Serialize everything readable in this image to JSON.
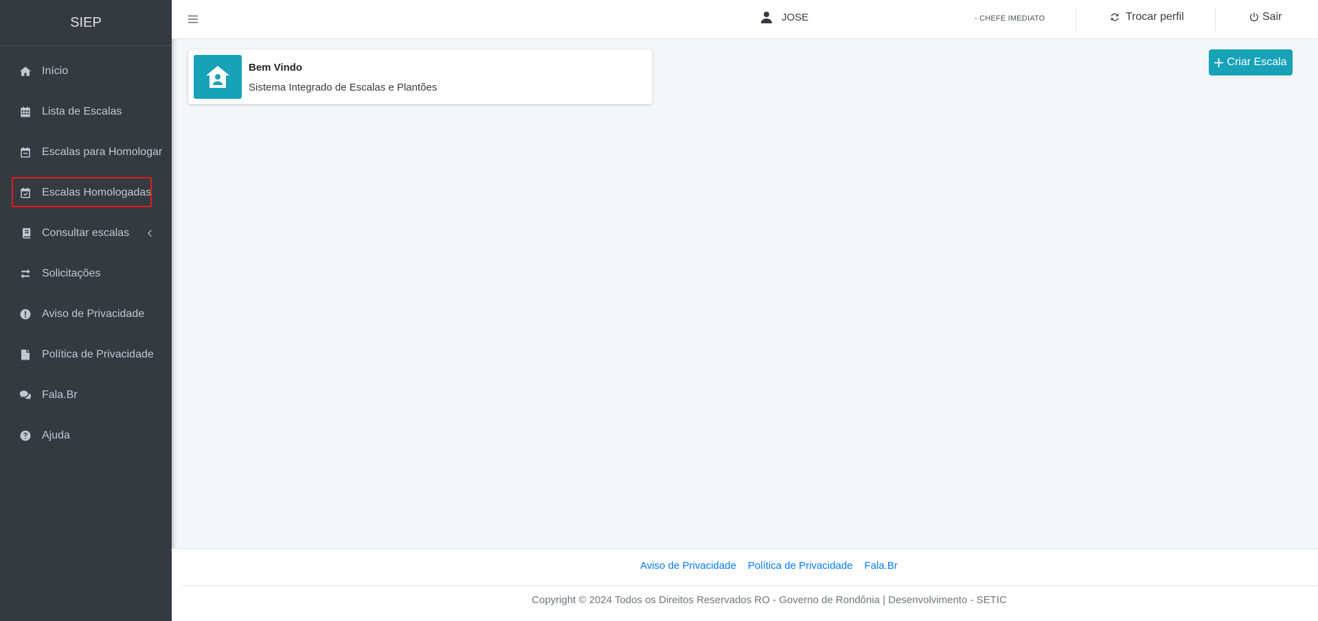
{
  "app": {
    "brand": "SIEP"
  },
  "sidebar": {
    "items": [
      {
        "label": "Início",
        "icon": "home-icon"
      },
      {
        "label": "Lista de Escalas",
        "icon": "calendar-grid-icon"
      },
      {
        "label": "Escalas para Homologar",
        "icon": "calendar-minus-icon"
      },
      {
        "label": "Escalas Homologadas",
        "icon": "calendar-check-icon"
      },
      {
        "label": "Consultar escalas",
        "icon": "book-icon"
      },
      {
        "label": "Solicitações",
        "icon": "exchange-icon"
      },
      {
        "label": "Aviso de Privacidade",
        "icon": "exclamation-circle-icon"
      },
      {
        "label": "Política de Privacidade",
        "icon": "file-icon"
      },
      {
        "label": "Fala.Br",
        "icon": "comments-icon"
      },
      {
        "label": "Ajuda",
        "icon": "question-circle-icon"
      }
    ]
  },
  "header": {
    "user_name": "JOSE",
    "role": "- CHEFE IMEDIATO",
    "switch_profile": "Trocar perfil",
    "logout": "Sair"
  },
  "welcome": {
    "title": "Bem Vindo",
    "subtitle": "Sistema Integrado de Escalas e Plantões"
  },
  "actions": {
    "create_label": "Criar Escala"
  },
  "footer": {
    "links": [
      "Aviso de Privacidade",
      "Política de Privacidade",
      "Fala.Br"
    ],
    "copyright": "Copyright © 2024 Todos os Direitos Reservados RO - Governo de Rondônia | Desenvolvimento - SETIC"
  },
  "colors": {
    "sidebar_bg": "#343a40",
    "accent": "#17a2b8",
    "link": "#007bff",
    "highlight": "#e31b1b"
  }
}
